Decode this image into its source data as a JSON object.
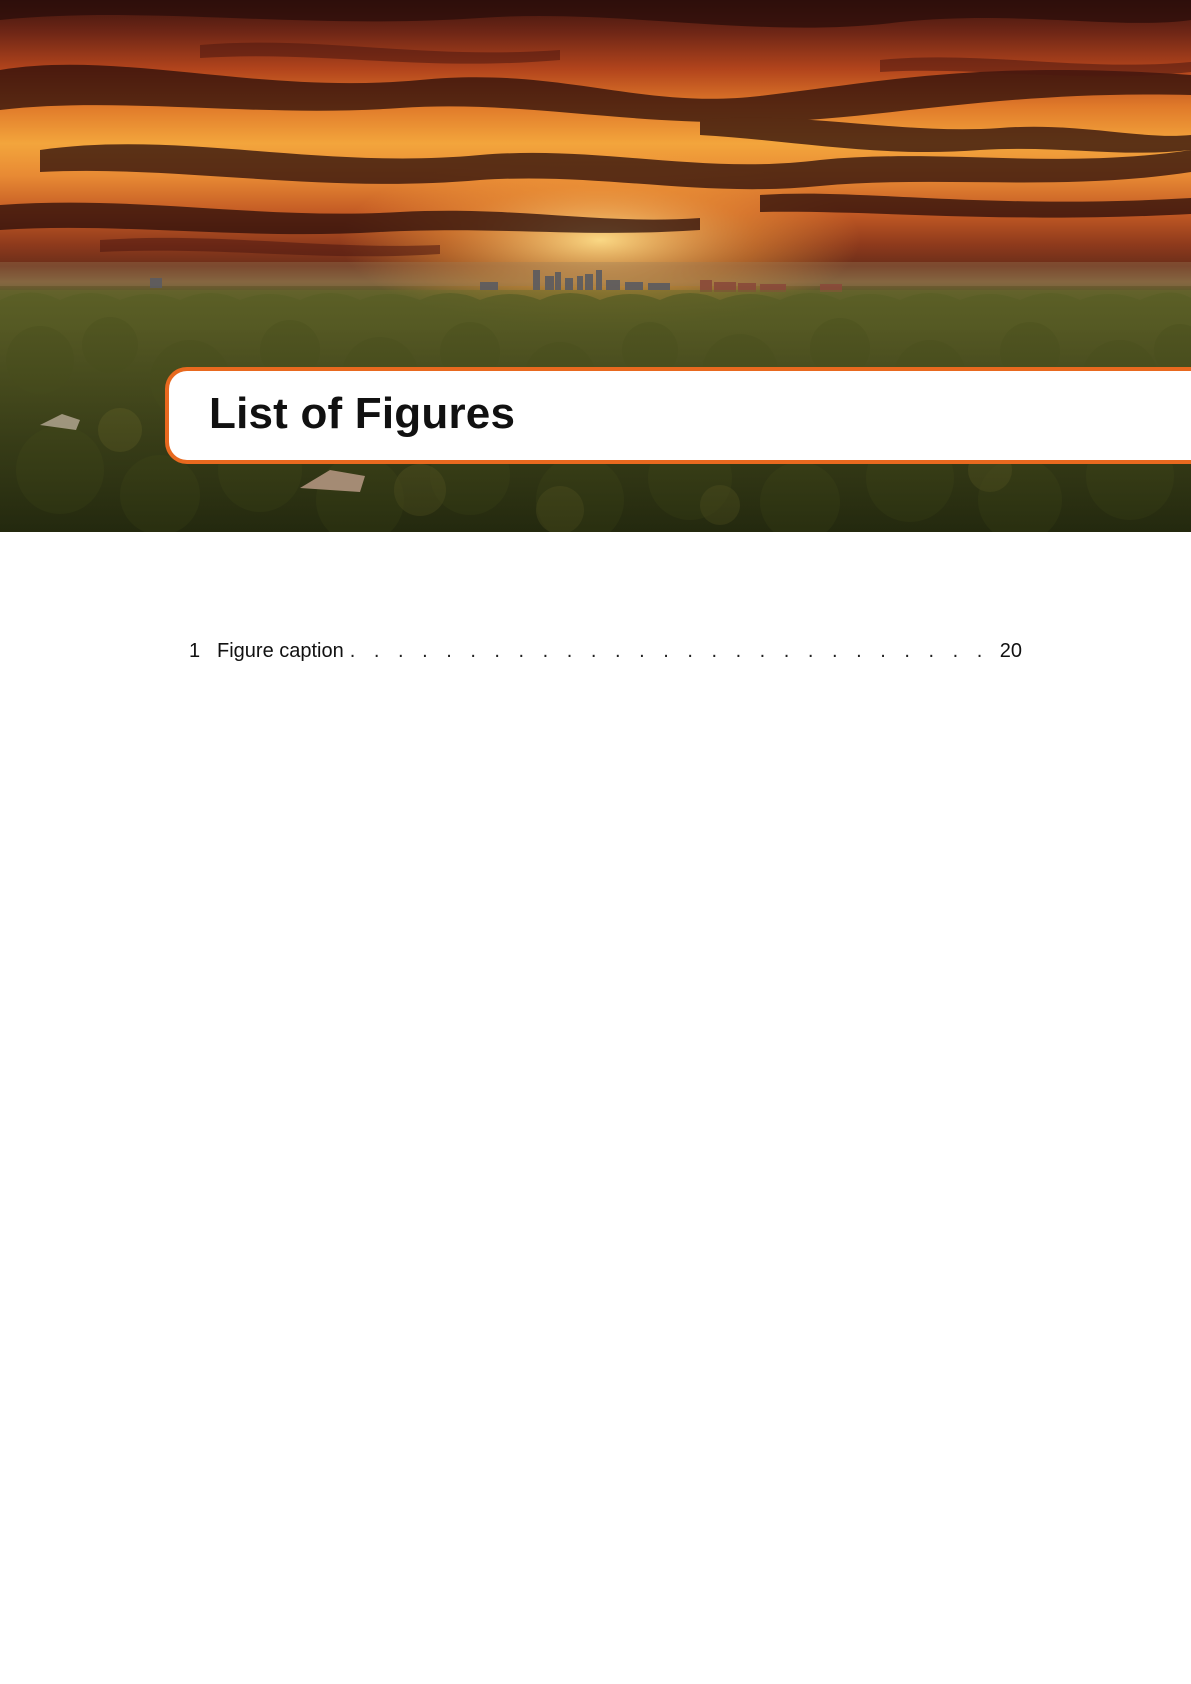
{
  "colors": {
    "accent": "#e8691f",
    "title_text": "#111111"
  },
  "header": {
    "title": "List of Figures"
  },
  "figures": [
    {
      "number": "1",
      "caption": "Figure caption",
      "page": "20"
    }
  ]
}
